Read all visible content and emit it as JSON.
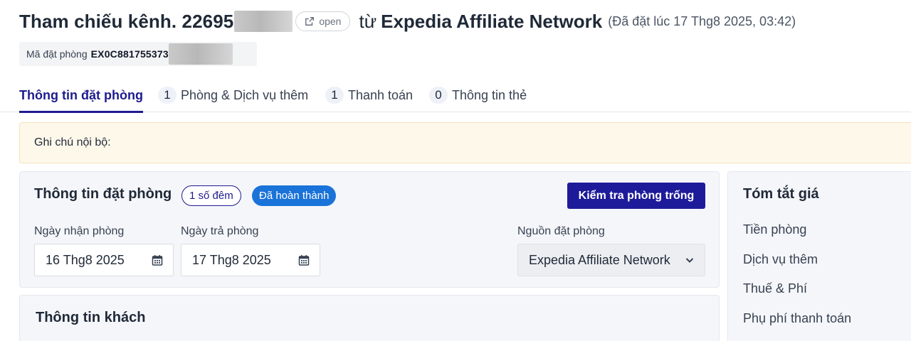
{
  "header": {
    "ref_prefix": "Tham chiếu kênh. 22695",
    "open_label": "open",
    "from_word": "từ",
    "source_name": "Expedia Affiliate Network",
    "booked_at": "(Đã đặt lúc 17 Thg8 2025, 03:42)"
  },
  "booking_code": {
    "label": "Mã đặt phòng",
    "value": "EX0C881755373"
  },
  "tabs": [
    {
      "label": "Thông tin đặt phòng",
      "count": ""
    },
    {
      "label": "Phòng & Dịch vụ thêm",
      "count": "1"
    },
    {
      "label": "Thanh toán",
      "count": "1"
    },
    {
      "label": "Thông tin thẻ",
      "count": "0"
    }
  ],
  "internal_note": {
    "label": "Ghi chú nội bộ:"
  },
  "booking_panel": {
    "title": "Thông tin đặt phòng",
    "nights_badge": "1 số đêm",
    "status_badge": "Đã hoàn thành",
    "check_availability_label": "Kiểm tra phòng trống",
    "checkin": {
      "label": "Ngày nhận phòng",
      "value": "16 Thg8 2025"
    },
    "checkout": {
      "label": "Ngày trả phòng",
      "value": "17 Thg8 2025"
    },
    "source": {
      "label": "Nguồn đặt phòng",
      "value": "Expedia Affiliate Network"
    }
  },
  "guest_panel": {
    "title": "Thông tin khách"
  },
  "price_summary": {
    "title": "Tóm tắt giá",
    "rows": [
      "Tiền phòng",
      "Dịch vụ thêm",
      "Thuế & Phí",
      "Phụ phí thanh toán"
    ]
  },
  "colors": {
    "accent": "#1e1b8f",
    "status_blue": "#1a73d9",
    "note_background": "#fef8ea",
    "panel_background": "#f5f6fa"
  },
  "icons": [
    "external-link-icon",
    "calendar-icon",
    "chevron-down-icon"
  ]
}
